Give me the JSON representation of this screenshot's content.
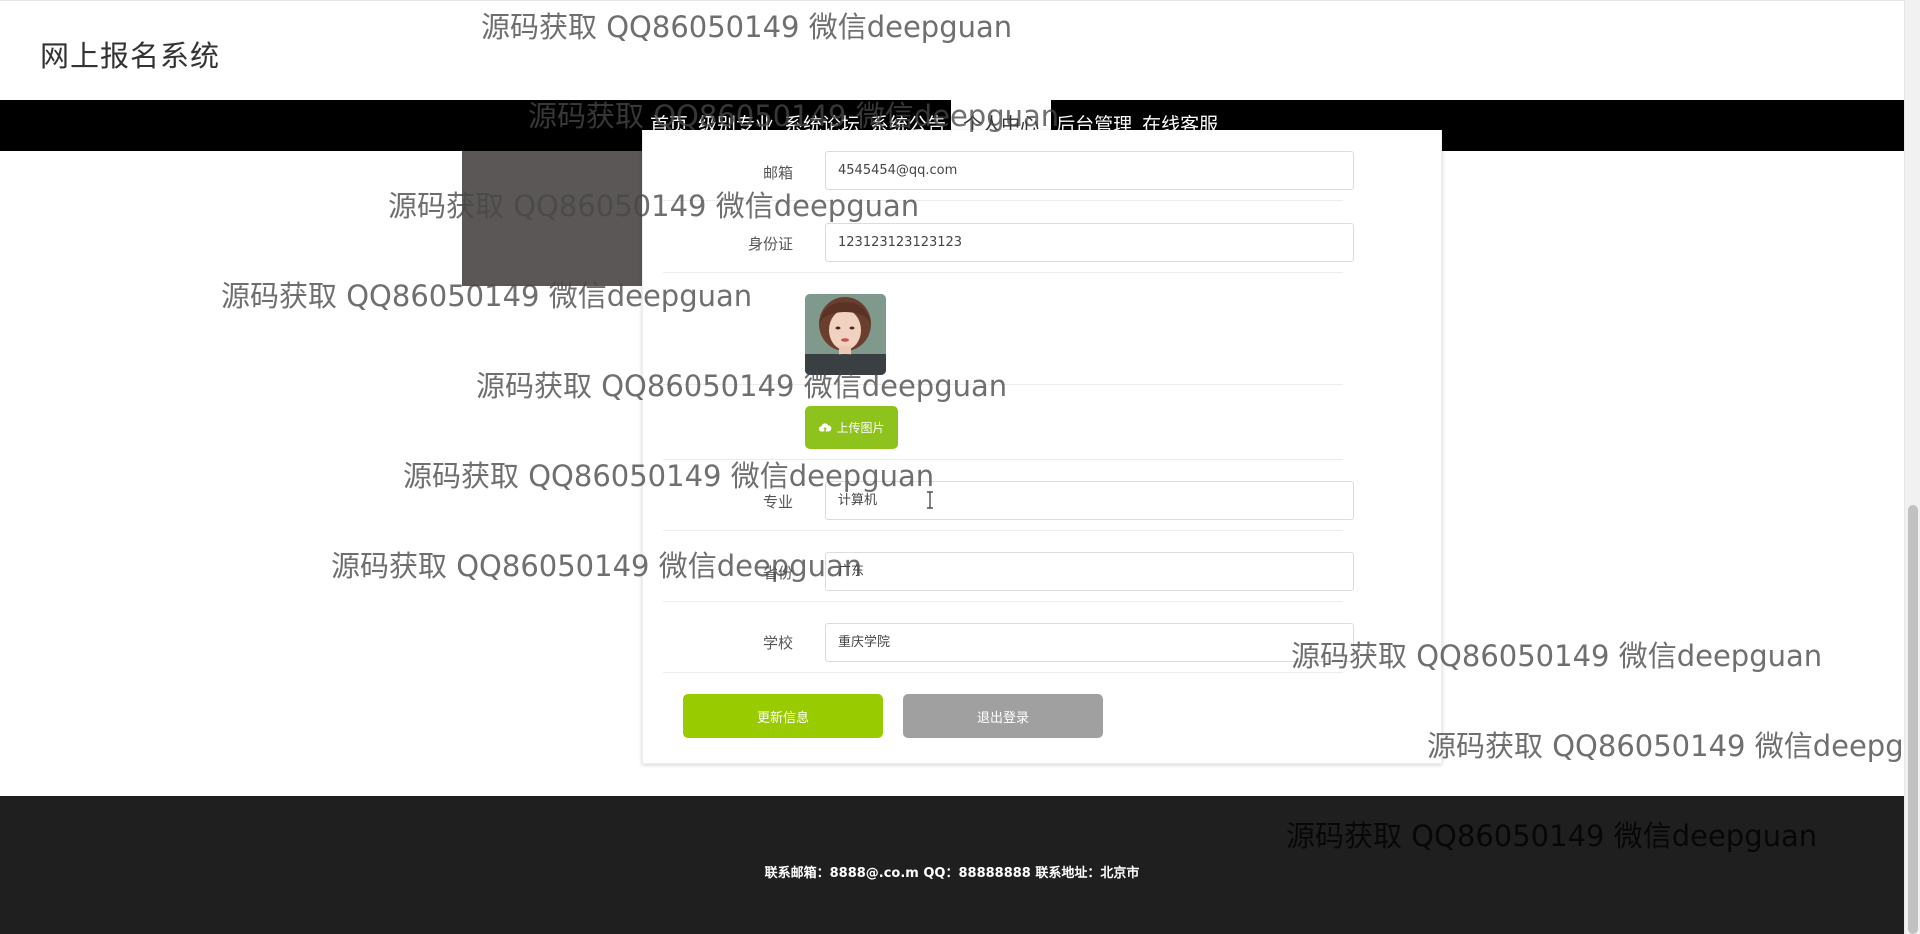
{
  "site": {
    "title": "网上报名系统"
  },
  "nav": {
    "items": [
      {
        "label": "首页"
      },
      {
        "label": "级别专业"
      },
      {
        "label": "系统论坛"
      },
      {
        "label": "系统公告"
      },
      {
        "label": "个人中心"
      },
      {
        "label": "后台管理"
      },
      {
        "label": "在线客服"
      }
    ],
    "active_index": 4
  },
  "form": {
    "email": {
      "label": "邮箱",
      "value": "4545454@qq.com"
    },
    "id_card": {
      "label": "身份证",
      "value": "123123123123123"
    },
    "upload_label": "上传图片",
    "major": {
      "label": "专业",
      "value": "计算机"
    },
    "province": {
      "label": "省份",
      "value": "广东"
    },
    "school": {
      "label": "学校",
      "value": "重庆学院"
    },
    "update_label": "更新信息",
    "logout_label": "退出登录"
  },
  "footer": {
    "text": "联系邮箱：8888@.co.m QQ：88888888 联系地址：北京市"
  },
  "watermark": {
    "text": "源码获取 QQ86050149 微信deepguan"
  },
  "colors": {
    "accent": "#99cc00",
    "nav_bg": "#000000",
    "footer_bg": "#1f1f1f",
    "logout": "#a0a0a0"
  },
  "icons": {
    "upload": "cloud-upload-icon",
    "cursor": "text-cursor-icon"
  }
}
